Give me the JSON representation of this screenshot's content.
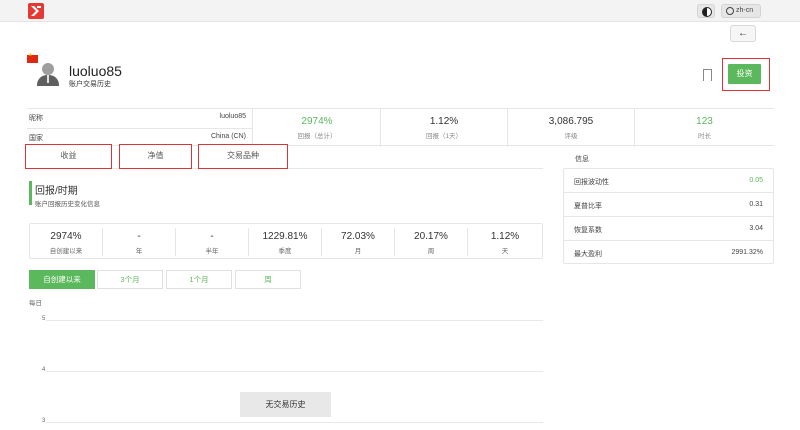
{
  "header": {
    "lang": "zh-cn",
    "back": "←"
  },
  "profile": {
    "username": "luoluo85",
    "subtitle": "账户交易历史",
    "invest_label": "投资"
  },
  "account_info": [
    {
      "key": "昵称",
      "value": "luoluo85"
    },
    {
      "key": "国家",
      "value": "China (CN)"
    }
  ],
  "stats": [
    {
      "value": "2974%",
      "label": "回报（总计）",
      "highlight": true
    },
    {
      "value": "1.12%",
      "label": "回报（1天）",
      "highlight": false
    },
    {
      "value": "3,086.795",
      "label": "评级",
      "highlight": false
    },
    {
      "value": "123",
      "label": "时长",
      "highlight": true
    }
  ],
  "tabs": [
    "收益",
    "净值",
    "交易品种"
  ],
  "returns_section": {
    "title": "回报/时期",
    "subtitle": "账户回报历史变化信息",
    "items": [
      {
        "value": "2974%",
        "label": "自创建以来"
      },
      {
        "value": "-",
        "label": "年"
      },
      {
        "value": "-",
        "label": "半年"
      },
      {
        "value": "1229.81%",
        "label": "季度"
      },
      {
        "value": "72.03%",
        "label": "月"
      },
      {
        "value": "20.17%",
        "label": "周"
      },
      {
        "value": "1.12%",
        "label": "天"
      }
    ]
  },
  "periods": [
    "自创建以来",
    "3个月",
    "1个月",
    "周"
  ],
  "chart": {
    "label": "每日",
    "ticks": [
      "5",
      "4",
      "3"
    ],
    "empty_text": "无交易历史"
  },
  "side_info": {
    "title": "信息",
    "rows": [
      {
        "key": "回报波动性",
        "value": "0.05",
        "highlight": true
      },
      {
        "key": "夏普比率",
        "value": "0.31",
        "highlight": false
      },
      {
        "key": "恢复系数",
        "value": "3.04",
        "highlight": false
      },
      {
        "key": "最大盈利",
        "value": "2991.32%",
        "highlight": false
      }
    ]
  },
  "colors": {
    "accent": "#5cb85c",
    "outline": "#d9343a",
    "logo": "#e53935"
  }
}
